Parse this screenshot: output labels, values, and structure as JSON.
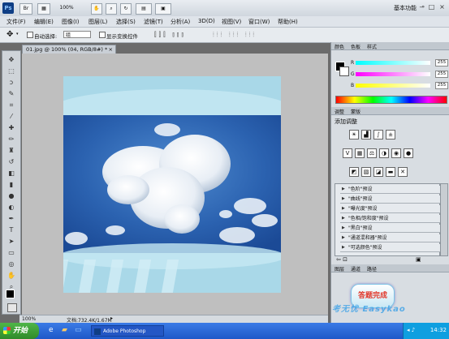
{
  "app": {
    "logo": "Ps",
    "zoom": "100%",
    "workspace": "基本功能",
    "window_controls": [
      "–",
      "□",
      "×"
    ]
  },
  "menu": [
    "文件(F)",
    "编辑(E)",
    "图像(I)",
    "图层(L)",
    "选择(S)",
    "滤镜(T)",
    "分析(A)",
    "3D(D)",
    "视图(V)",
    "窗口(W)",
    "帮助(H)"
  ],
  "options": {
    "auto_select_label": "自动选择:",
    "auto_select_value": "组",
    "show_transform_label": "显示变换控件"
  },
  "document": {
    "tab_title": "01.jpg @ 100% (04, RGB/8#) *",
    "zoom": "100%",
    "doc_info": "文档:732.4K/1.67M"
  },
  "color_panel": {
    "tabs": [
      "颜色",
      "色板",
      "样式"
    ],
    "channels": [
      {
        "label": "R",
        "value": "255",
        "color": "#ff3030"
      },
      {
        "label": "G",
        "value": "255",
        "color": "#30ff30"
      },
      {
        "label": "B",
        "value": "255",
        "color": "#3030ff"
      }
    ]
  },
  "adjust_panel": {
    "tabs": [
      "调整",
      "蒙版"
    ],
    "title": "添加调整",
    "presets": [
      "\"色阶\"预设",
      "\"曲线\"预设",
      "\"曝光度\"预设",
      "\"色相/饱和度\"预设",
      "\"黑白\"预设",
      "\"通道混和器\"预设",
      "\"可选颜色\"预设"
    ]
  },
  "layers_panel": {
    "tabs": [
      "图层",
      "通道",
      "路径"
    ]
  },
  "overlay": {
    "stamp": "答题完成",
    "watermark": "考无忧 Easykao"
  },
  "taskbar": {
    "start": "开始",
    "task_photoshop": "Adobe Photoshop",
    "clock": "14:32"
  },
  "colors": {
    "accent": "#1e58c8",
    "sky": "#2f67b3",
    "photo_frame": "#9fcfe0"
  }
}
